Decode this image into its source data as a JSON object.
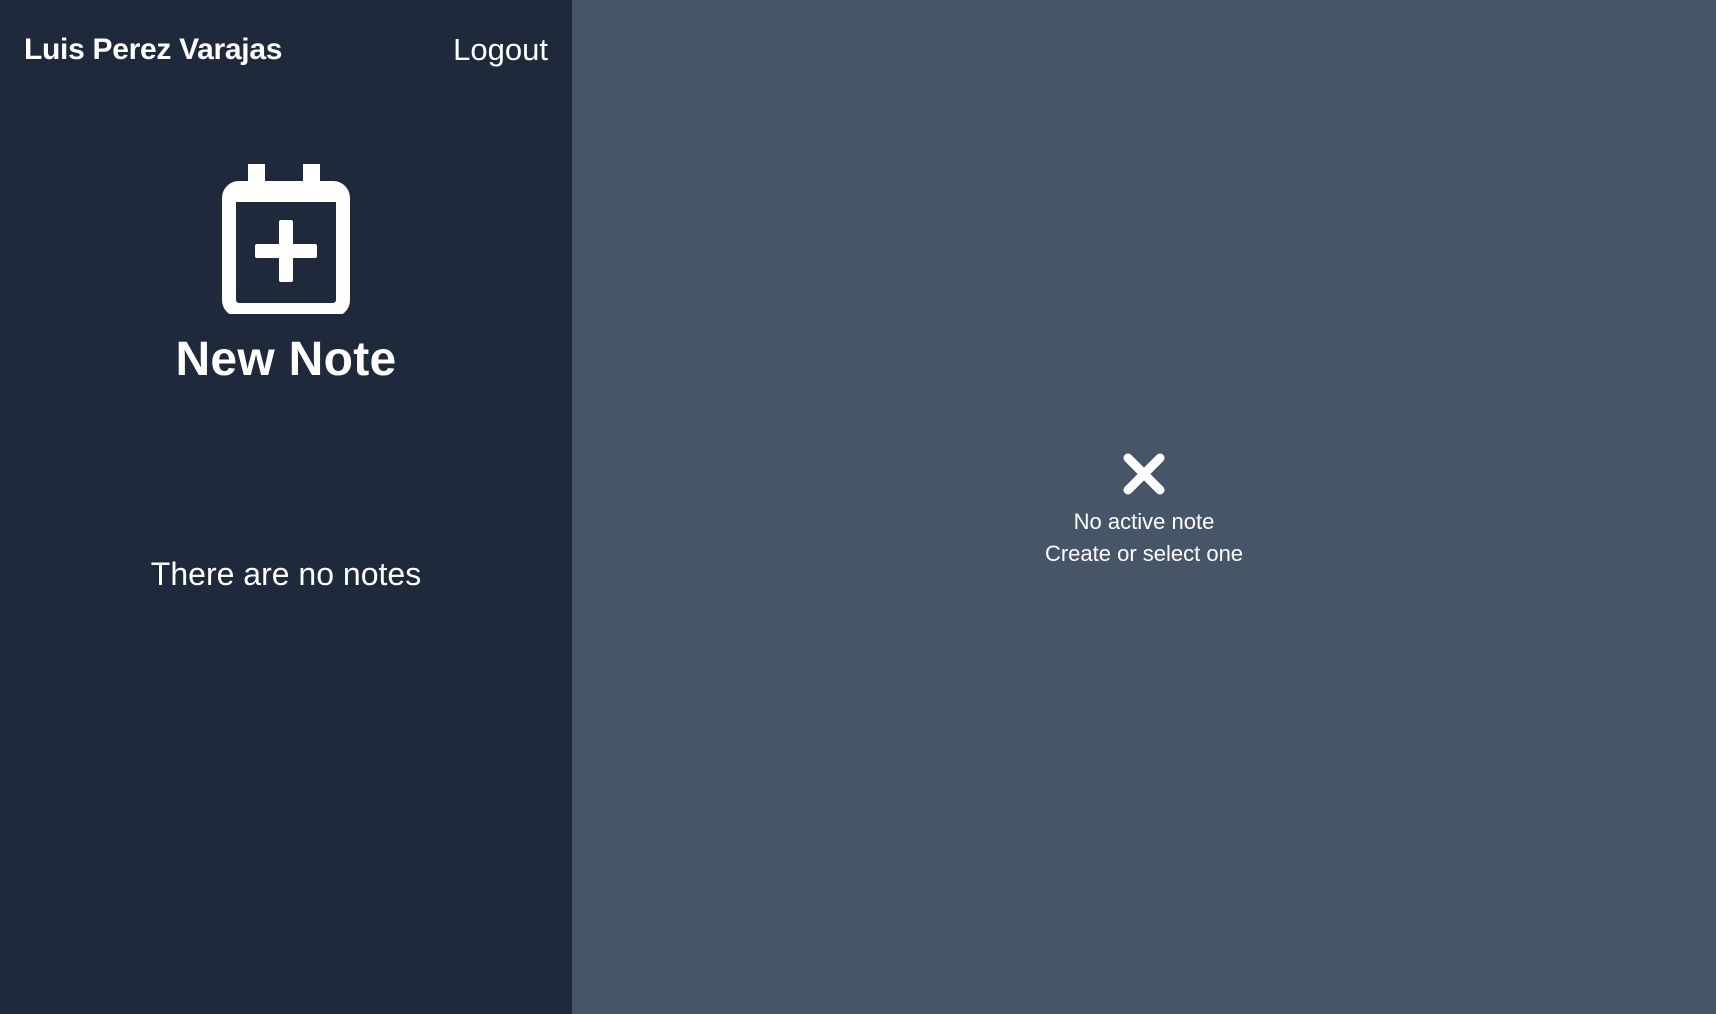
{
  "sidebar": {
    "user_name": "Luis Perez Varajas",
    "logout_label": "Logout",
    "new_note": {
      "icon": "calendar-plus-icon",
      "label": "New Note"
    },
    "empty_message": "There are no notes"
  },
  "main": {
    "empty_state": {
      "icon": "close-icon",
      "title": "No active note",
      "subtitle": "Create or select one"
    }
  },
  "colors": {
    "sidebar_bg": "#1e293b",
    "main_bg": "#475569",
    "text": "#ffffff"
  }
}
